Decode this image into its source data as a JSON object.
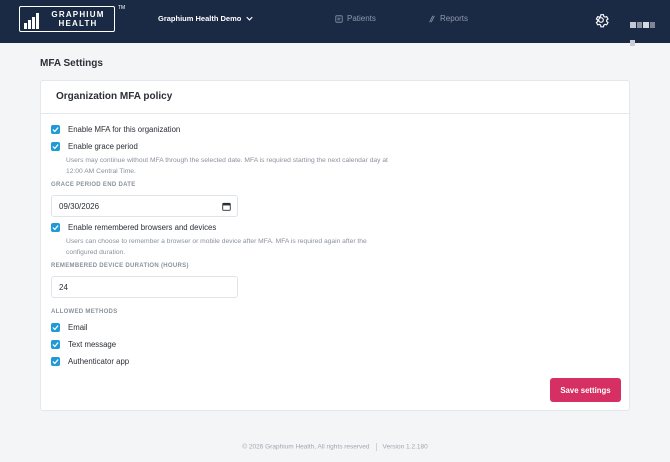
{
  "header": {
    "logo_text_line1": "GRAPHIUM",
    "logo_text_line2": "HEALTH",
    "logo_tm": "TM",
    "org_name": "Graphium Health Demo",
    "nav": [
      {
        "label": "Patients",
        "icon": "patients-icon"
      },
      {
        "label": "Reports",
        "icon": "reports-icon"
      }
    ]
  },
  "page_title": "MFA Settings",
  "card": {
    "title": "Organization MFA policy",
    "enable_mfa": {
      "label": "Enable MFA for this organization",
      "checked": true
    },
    "grace_period": {
      "label": "Enable grace period",
      "checked": true,
      "help": "Users may continue without MFA through the selected date. MFA is required starting the next calendar day at 12:00 AM Central Time.",
      "end_date_label": "GRACE PERIOD END DATE",
      "end_date_value": "09/30/2026"
    },
    "remembered": {
      "label": "Enable remembered browsers and devices",
      "checked": true,
      "help": "Users can choose to remember a browser or mobile device after MFA. MFA is required again after the configured duration.",
      "duration_label": "REMEMBERED DEVICE DURATION (HOURS)",
      "duration_value": "24"
    },
    "allowed_methods_label": "ALLOWED METHODS",
    "methods": [
      {
        "label": "Email",
        "checked": true
      },
      {
        "label": "Text message",
        "checked": true
      },
      {
        "label": "Authenticator app",
        "checked": true
      }
    ],
    "save_label": "Save settings"
  },
  "footer": {
    "copyright": "© 2026 Graphium Health, All rights reserved",
    "version": "Version 1.2.180"
  },
  "colors": {
    "nav_bg": "#1a2a44",
    "accent_checkbox": "#1f9ad6",
    "primary_button": "#d62f63"
  }
}
